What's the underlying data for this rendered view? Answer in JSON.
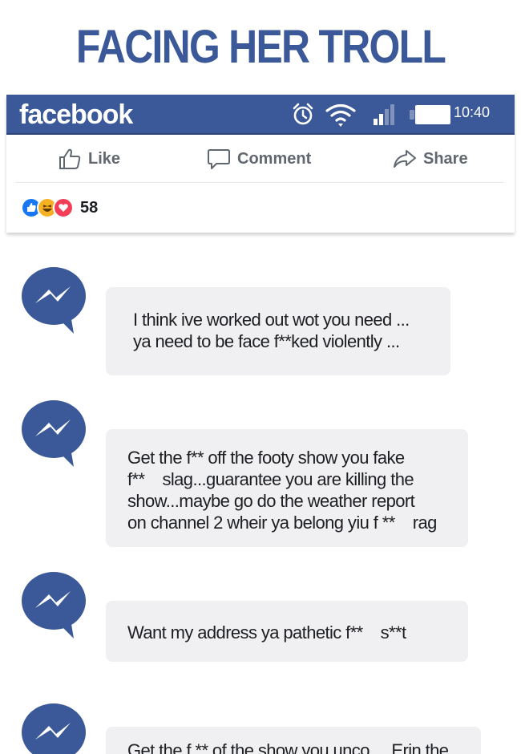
{
  "headline": "FACING HER TROLL",
  "app": {
    "logo": "facebook",
    "status_bar": {
      "icons": [
        "alarm-clock-icon",
        "wifi-icon",
        "signal-icon",
        "battery-icon"
      ],
      "time": "10:40"
    },
    "actions": {
      "like": "Like",
      "comment": "Comment",
      "share": "Share"
    },
    "reactions": {
      "icons": [
        "like-reaction-icon",
        "haha-reaction-icon",
        "love-reaction-icon"
      ],
      "count": "58"
    }
  },
  "messages": [
    {
      "lines": [
        "I think ive worked out wot you need ...",
        "ya need to be face f**ked violently ..."
      ]
    },
    {
      "lines": [
        "Get the f** off the footy show you fake",
        "f**    slag...guarantee you are killing the",
        "show...maybe go do the weather report",
        "on channel 2 wheir ya belong yiu f **    rag"
      ]
    },
    {
      "lines": [
        "Want my address ya pathetic f**    s**t"
      ]
    },
    {
      "lines": [
        "Get the f ** of the show you unco     Erin the"
      ]
    }
  ],
  "colors": {
    "brand": "#3b5998",
    "bubble": "#f0f0f2",
    "action_text": "#606770",
    "like_blue": "#1877f2",
    "love_red": "#f33e58",
    "haha_yellow": "#f7b125"
  }
}
